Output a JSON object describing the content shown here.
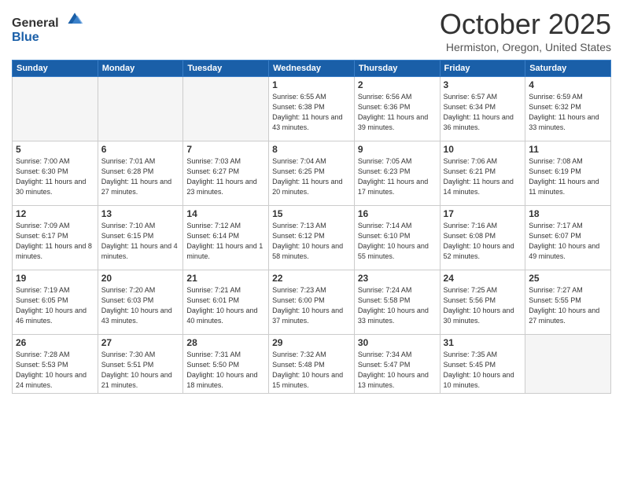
{
  "header": {
    "logo_line1": "General",
    "logo_line2": "Blue",
    "month_title": "October 2025",
    "location": "Hermiston, Oregon, United States"
  },
  "weekdays": [
    "Sunday",
    "Monday",
    "Tuesday",
    "Wednesday",
    "Thursday",
    "Friday",
    "Saturday"
  ],
  "weeks": [
    [
      {
        "day": "",
        "sunrise": "",
        "sunset": "",
        "daylight": "",
        "empty": true
      },
      {
        "day": "",
        "sunrise": "",
        "sunset": "",
        "daylight": "",
        "empty": true
      },
      {
        "day": "",
        "sunrise": "",
        "sunset": "",
        "daylight": "",
        "empty": true
      },
      {
        "day": "1",
        "sunrise": "Sunrise: 6:55 AM",
        "sunset": "Sunset: 6:38 PM",
        "daylight": "Daylight: 11 hours and 43 minutes.",
        "empty": false
      },
      {
        "day": "2",
        "sunrise": "Sunrise: 6:56 AM",
        "sunset": "Sunset: 6:36 PM",
        "daylight": "Daylight: 11 hours and 39 minutes.",
        "empty": false
      },
      {
        "day": "3",
        "sunrise": "Sunrise: 6:57 AM",
        "sunset": "Sunset: 6:34 PM",
        "daylight": "Daylight: 11 hours and 36 minutes.",
        "empty": false
      },
      {
        "day": "4",
        "sunrise": "Sunrise: 6:59 AM",
        "sunset": "Sunset: 6:32 PM",
        "daylight": "Daylight: 11 hours and 33 minutes.",
        "empty": false
      }
    ],
    [
      {
        "day": "5",
        "sunrise": "Sunrise: 7:00 AM",
        "sunset": "Sunset: 6:30 PM",
        "daylight": "Daylight: 11 hours and 30 minutes.",
        "empty": false
      },
      {
        "day": "6",
        "sunrise": "Sunrise: 7:01 AM",
        "sunset": "Sunset: 6:28 PM",
        "daylight": "Daylight: 11 hours and 27 minutes.",
        "empty": false
      },
      {
        "day": "7",
        "sunrise": "Sunrise: 7:03 AM",
        "sunset": "Sunset: 6:27 PM",
        "daylight": "Daylight: 11 hours and 23 minutes.",
        "empty": false
      },
      {
        "day": "8",
        "sunrise": "Sunrise: 7:04 AM",
        "sunset": "Sunset: 6:25 PM",
        "daylight": "Daylight: 11 hours and 20 minutes.",
        "empty": false
      },
      {
        "day": "9",
        "sunrise": "Sunrise: 7:05 AM",
        "sunset": "Sunset: 6:23 PM",
        "daylight": "Daylight: 11 hours and 17 minutes.",
        "empty": false
      },
      {
        "day": "10",
        "sunrise": "Sunrise: 7:06 AM",
        "sunset": "Sunset: 6:21 PM",
        "daylight": "Daylight: 11 hours and 14 minutes.",
        "empty": false
      },
      {
        "day": "11",
        "sunrise": "Sunrise: 7:08 AM",
        "sunset": "Sunset: 6:19 PM",
        "daylight": "Daylight: 11 hours and 11 minutes.",
        "empty": false
      }
    ],
    [
      {
        "day": "12",
        "sunrise": "Sunrise: 7:09 AM",
        "sunset": "Sunset: 6:17 PM",
        "daylight": "Daylight: 11 hours and 8 minutes.",
        "empty": false
      },
      {
        "day": "13",
        "sunrise": "Sunrise: 7:10 AM",
        "sunset": "Sunset: 6:15 PM",
        "daylight": "Daylight: 11 hours and 4 minutes.",
        "empty": false
      },
      {
        "day": "14",
        "sunrise": "Sunrise: 7:12 AM",
        "sunset": "Sunset: 6:14 PM",
        "daylight": "Daylight: 11 hours and 1 minute.",
        "empty": false
      },
      {
        "day": "15",
        "sunrise": "Sunrise: 7:13 AM",
        "sunset": "Sunset: 6:12 PM",
        "daylight": "Daylight: 10 hours and 58 minutes.",
        "empty": false
      },
      {
        "day": "16",
        "sunrise": "Sunrise: 7:14 AM",
        "sunset": "Sunset: 6:10 PM",
        "daylight": "Daylight: 10 hours and 55 minutes.",
        "empty": false
      },
      {
        "day": "17",
        "sunrise": "Sunrise: 7:16 AM",
        "sunset": "Sunset: 6:08 PM",
        "daylight": "Daylight: 10 hours and 52 minutes.",
        "empty": false
      },
      {
        "day": "18",
        "sunrise": "Sunrise: 7:17 AM",
        "sunset": "Sunset: 6:07 PM",
        "daylight": "Daylight: 10 hours and 49 minutes.",
        "empty": false
      }
    ],
    [
      {
        "day": "19",
        "sunrise": "Sunrise: 7:19 AM",
        "sunset": "Sunset: 6:05 PM",
        "daylight": "Daylight: 10 hours and 46 minutes.",
        "empty": false
      },
      {
        "day": "20",
        "sunrise": "Sunrise: 7:20 AM",
        "sunset": "Sunset: 6:03 PM",
        "daylight": "Daylight: 10 hours and 43 minutes.",
        "empty": false
      },
      {
        "day": "21",
        "sunrise": "Sunrise: 7:21 AM",
        "sunset": "Sunset: 6:01 PM",
        "daylight": "Daylight: 10 hours and 40 minutes.",
        "empty": false
      },
      {
        "day": "22",
        "sunrise": "Sunrise: 7:23 AM",
        "sunset": "Sunset: 6:00 PM",
        "daylight": "Daylight: 10 hours and 37 minutes.",
        "empty": false
      },
      {
        "day": "23",
        "sunrise": "Sunrise: 7:24 AM",
        "sunset": "Sunset: 5:58 PM",
        "daylight": "Daylight: 10 hours and 33 minutes.",
        "empty": false
      },
      {
        "day": "24",
        "sunrise": "Sunrise: 7:25 AM",
        "sunset": "Sunset: 5:56 PM",
        "daylight": "Daylight: 10 hours and 30 minutes.",
        "empty": false
      },
      {
        "day": "25",
        "sunrise": "Sunrise: 7:27 AM",
        "sunset": "Sunset: 5:55 PM",
        "daylight": "Daylight: 10 hours and 27 minutes.",
        "empty": false
      }
    ],
    [
      {
        "day": "26",
        "sunrise": "Sunrise: 7:28 AM",
        "sunset": "Sunset: 5:53 PM",
        "daylight": "Daylight: 10 hours and 24 minutes.",
        "empty": false
      },
      {
        "day": "27",
        "sunrise": "Sunrise: 7:30 AM",
        "sunset": "Sunset: 5:51 PM",
        "daylight": "Daylight: 10 hours and 21 minutes.",
        "empty": false
      },
      {
        "day": "28",
        "sunrise": "Sunrise: 7:31 AM",
        "sunset": "Sunset: 5:50 PM",
        "daylight": "Daylight: 10 hours and 18 minutes.",
        "empty": false
      },
      {
        "day": "29",
        "sunrise": "Sunrise: 7:32 AM",
        "sunset": "Sunset: 5:48 PM",
        "daylight": "Daylight: 10 hours and 15 minutes.",
        "empty": false
      },
      {
        "day": "30",
        "sunrise": "Sunrise: 7:34 AM",
        "sunset": "Sunset: 5:47 PM",
        "daylight": "Daylight: 10 hours and 13 minutes.",
        "empty": false
      },
      {
        "day": "31",
        "sunrise": "Sunrise: 7:35 AM",
        "sunset": "Sunset: 5:45 PM",
        "daylight": "Daylight: 10 hours and 10 minutes.",
        "empty": false
      },
      {
        "day": "",
        "sunrise": "",
        "sunset": "",
        "daylight": "",
        "empty": true
      }
    ]
  ]
}
